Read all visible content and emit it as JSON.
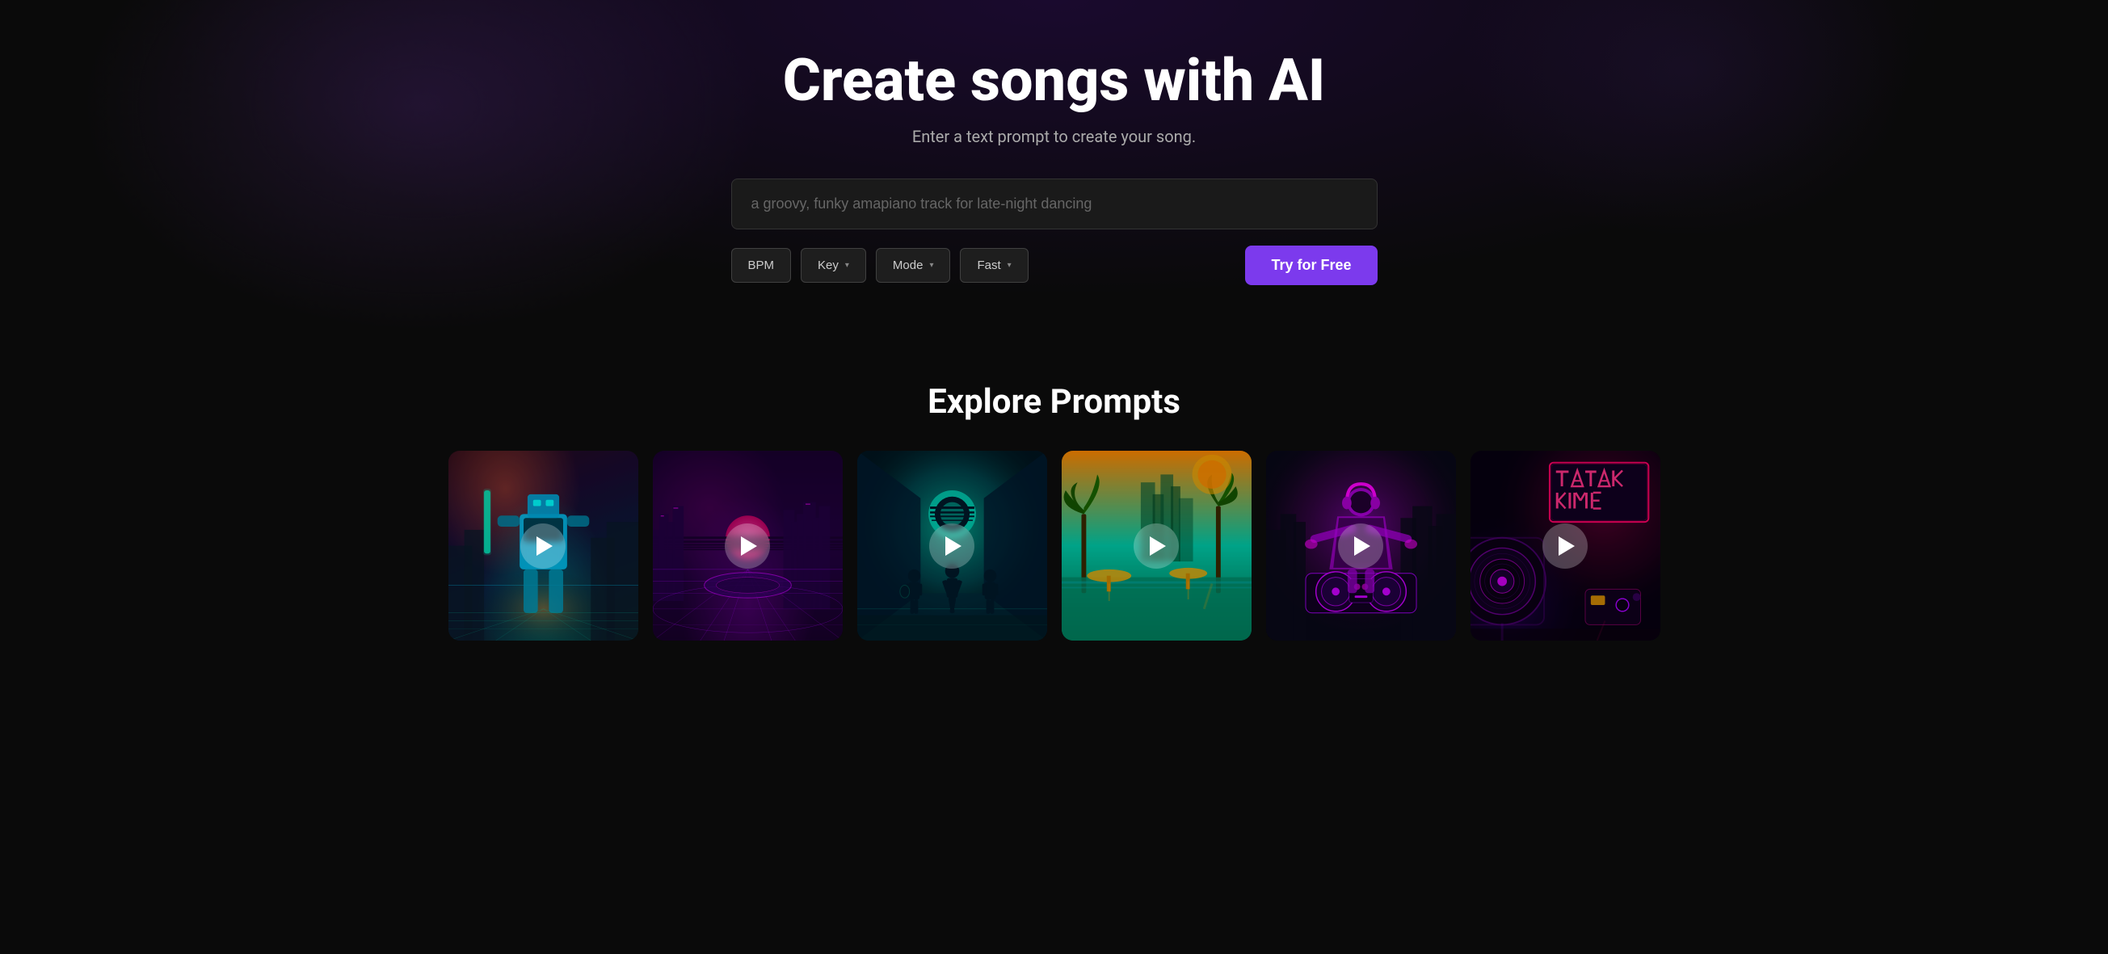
{
  "hero": {
    "title": "Create songs with AI",
    "subtitle": "Enter a text prompt to create your song.",
    "input": {
      "value": "a groovy, funky amapiano track for late-night dancing",
      "placeholder": "a groovy, funky amapiano track for late-night dancing"
    },
    "controls": {
      "bpm_label": "BPM",
      "key_label": "Key",
      "key_arrow": "▾",
      "mode_label": "Mode",
      "mode_arrow": "▾",
      "speed_label": "Fast",
      "speed_arrow": "▾",
      "try_button": "Try for Free"
    }
  },
  "explore": {
    "title": "Explore Prompts",
    "cards": [
      {
        "id": 1,
        "theme": "card-1",
        "alt": "Cyberpunk robot warrior"
      },
      {
        "id": 2,
        "theme": "card-2",
        "alt": "Neon synthwave city"
      },
      {
        "id": 3,
        "theme": "card-3",
        "alt": "Teal futuristic corridor with band"
      },
      {
        "id": 4,
        "theme": "card-4",
        "alt": "Tropical paradise sunset"
      },
      {
        "id": 5,
        "theme": "card-5",
        "alt": "DJ in purple neon"
      },
      {
        "id": 6,
        "theme": "card-6",
        "alt": "Neon sign nightclub"
      }
    ]
  }
}
